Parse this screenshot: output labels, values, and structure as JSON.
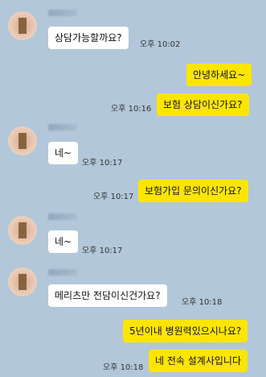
{
  "messages": [
    {
      "sender": "other",
      "text": "상담가능할까요?",
      "time": "오후 10:02"
    },
    {
      "sender": "me",
      "text": "안녕하세요~",
      "time": ""
    },
    {
      "sender": "me",
      "text": "보험 상담이신가요?",
      "time": "오후 10:16"
    },
    {
      "sender": "other",
      "text": "네~",
      "time": "오후 10:17"
    },
    {
      "sender": "me",
      "text": "보험가입 문의이신가요?",
      "time": "오후 10:17"
    },
    {
      "sender": "other",
      "text": "네~",
      "time": "오후 10:17"
    },
    {
      "sender": "other",
      "text": "메리츠만 전담이신건가요?",
      "time": "오후 10:18"
    },
    {
      "sender": "me",
      "text": "5년이내 병원력있으시나요?",
      "time": ""
    },
    {
      "sender": "me",
      "text": "네 전속 설계사입니다",
      "time": "오후 10:18"
    }
  ],
  "colors": {
    "background": "#b2c7d9",
    "my_bubble": "#fee500",
    "their_bubble": "#ffffff"
  }
}
